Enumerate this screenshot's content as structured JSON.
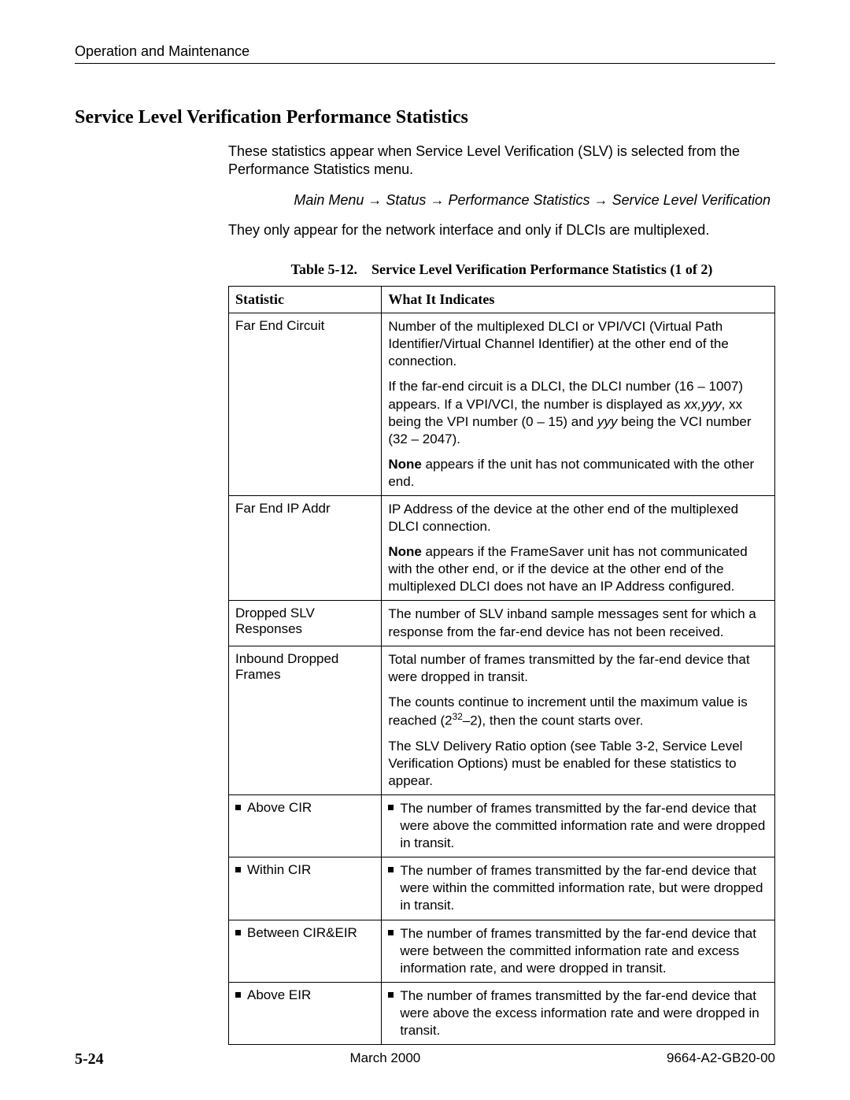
{
  "chapter": "Operation and Maintenance",
  "section_title": "Service Level Verification Performance Statistics",
  "intro1": "These statistics appear when Service Level Verification (SLV) is selected from the Performance Statistics menu.",
  "breadcrumb": {
    "a": "Main Menu",
    "b": "Status",
    "c": "Performance Statistics",
    "d": "Service Level Verification"
  },
  "intro2": "They only appear for the network interface and only if DLCIs are multiplexed.",
  "table_caption_label": "Table 5-12.",
  "table_caption_text": "Service Level Verification Performance Statistics (1 of 2)",
  "col1": "Statistic",
  "col2": "What It Indicates",
  "rows": {
    "r0": {
      "stat": "Far End Circuit",
      "p1": "Number of the multiplexed DLCI or VPI/VCI (Virtual Path Identifier/Virtual Channel Identifier) at the other end of the connection.",
      "p2a": "If the far-end circuit is a DLCI, the DLCI number (16 – 1007) appears. If a VPI/VCI, the number is displayed as ",
      "p2b": "xx,yyy",
      "p2c": ", xx being the VPI number (0 – 15) and ",
      "p2d": "yyy",
      "p2e": " being the VCI number (32 – 2047).",
      "p3a": "None",
      "p3b": " appears if the unit has not communicated with the other end."
    },
    "r1": {
      "stat": "Far End IP Addr",
      "p1": "IP Address of the device at the other end of the multiplexed DLCI connection.",
      "p2a": "None",
      "p2b": " appears if the FrameSaver unit has not communicated with the other end, or if the device at the other end of the multiplexed DLCI does not have an IP Address configured."
    },
    "r2": {
      "stat": "Dropped SLV Responses",
      "p1": "The number of SLV inband sample messages sent for which a response from the far-end device has not been received."
    },
    "r3": {
      "stat": "Inbound Dropped Frames",
      "p1": "Total number of frames transmitted by the far-end device that were dropped in transit.",
      "p2a": "The counts continue to increment until the maximum value is reached (2",
      "p2b": "32",
      "p2c": "–2), then the count starts over.",
      "p3a": "The ",
      "p3b": "SLV Delivery Ratio",
      "p3c": " option (see Table 3-2, Service Level Verification Options) must be enabled for these statistics to appear."
    },
    "r4": {
      "stat": "Above CIR",
      "p1": "The number of frames transmitted by the far-end device that were above the committed information rate and were dropped in transit."
    },
    "r5": {
      "stat": "Within CIR",
      "p1": "The number of frames transmitted by the far-end device that were within the committed information rate, but were dropped in transit."
    },
    "r6": {
      "stat": "Between CIR&EIR",
      "p1": "The number of frames transmitted by the far-end device that were between the committed information rate and excess information rate, and were dropped in transit."
    },
    "r7": {
      "stat": "Above EIR",
      "p1": "The number of frames transmitted by the far-end device that were above the excess information rate and were dropped in transit."
    }
  },
  "footer": {
    "page": "5-24",
    "date": "March 2000",
    "docnum": "9664-A2-GB20-00"
  }
}
